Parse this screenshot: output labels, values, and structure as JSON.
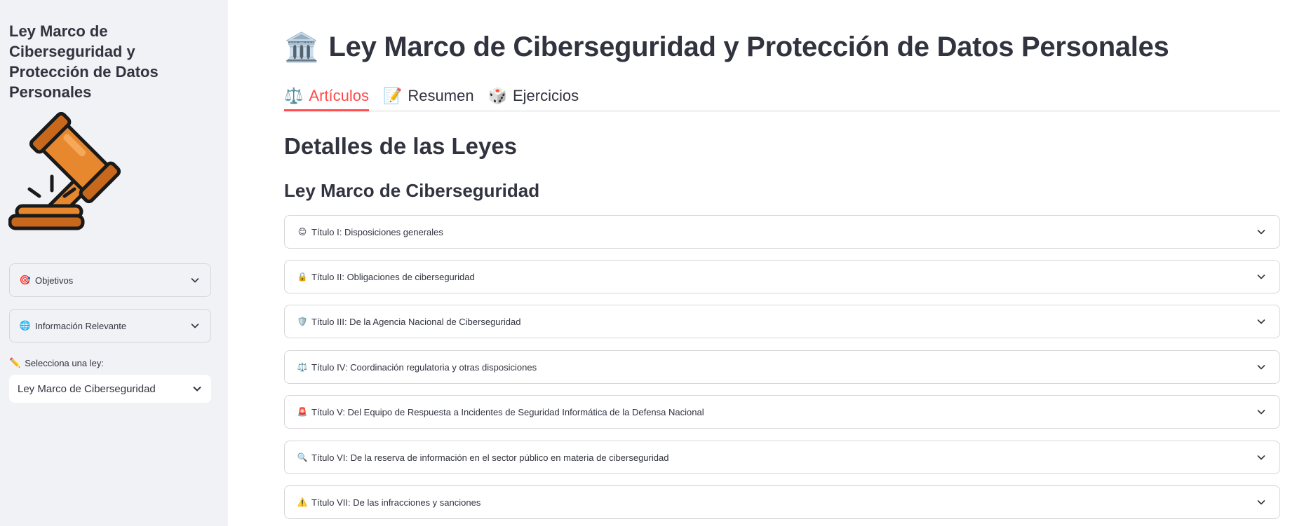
{
  "sidebar": {
    "title": "Ley Marco de Ciberseguridad y Protección de Datos Personales",
    "gavel_icon": "gavel-icon",
    "expanders": [
      {
        "emoji": "🎯",
        "label": "Objetivos"
      },
      {
        "emoji": "🌐",
        "label": "Información Relevante"
      }
    ],
    "select_label_emoji": "✏️",
    "select_label": "Selecciona una ley:",
    "select_value": "Ley Marco de Ciberseguridad"
  },
  "main": {
    "title_emoji": "🏛️",
    "title": "Ley Marco de Ciberseguridad y Protección de Datos Personales",
    "tabs": [
      {
        "emoji": "⚖️",
        "label": "Artículos",
        "active": true
      },
      {
        "emoji": "📝",
        "label": "Resumen",
        "active": false
      },
      {
        "emoji": "🎲",
        "label": "Ejercicios",
        "active": false
      }
    ],
    "section_heading": "Detalles de las Leyes",
    "sub_heading": "Ley Marco de Ciberseguridad",
    "titulos": [
      {
        "emoji": "😊",
        "label": "Título I: Disposiciones generales"
      },
      {
        "emoji": "🔒",
        "label": "Título II: Obligaciones de ciberseguridad"
      },
      {
        "emoji": "🛡️",
        "label": "Título III: De la Agencia Nacional de Ciberseguridad"
      },
      {
        "emoji": "⚖️",
        "label": "Título IV: Coordinación regulatoria y otras disposiciones"
      },
      {
        "emoji": "🚨",
        "label": "Título V: Del Equipo de Respuesta a Incidentes de Seguridad Informática de la Defensa Nacional"
      },
      {
        "emoji": "🔍",
        "label": "Título VI: De la reserva de información en el sector público en materia de ciberseguridad"
      },
      {
        "emoji": "⚠️",
        "label": "Título VII: De las infracciones y sanciones"
      }
    ]
  },
  "colors": {
    "accent": "#ff4b4b",
    "sidebar_bg": "#f0f2f6",
    "text": "#31333f",
    "border": "#d6d6d9"
  }
}
